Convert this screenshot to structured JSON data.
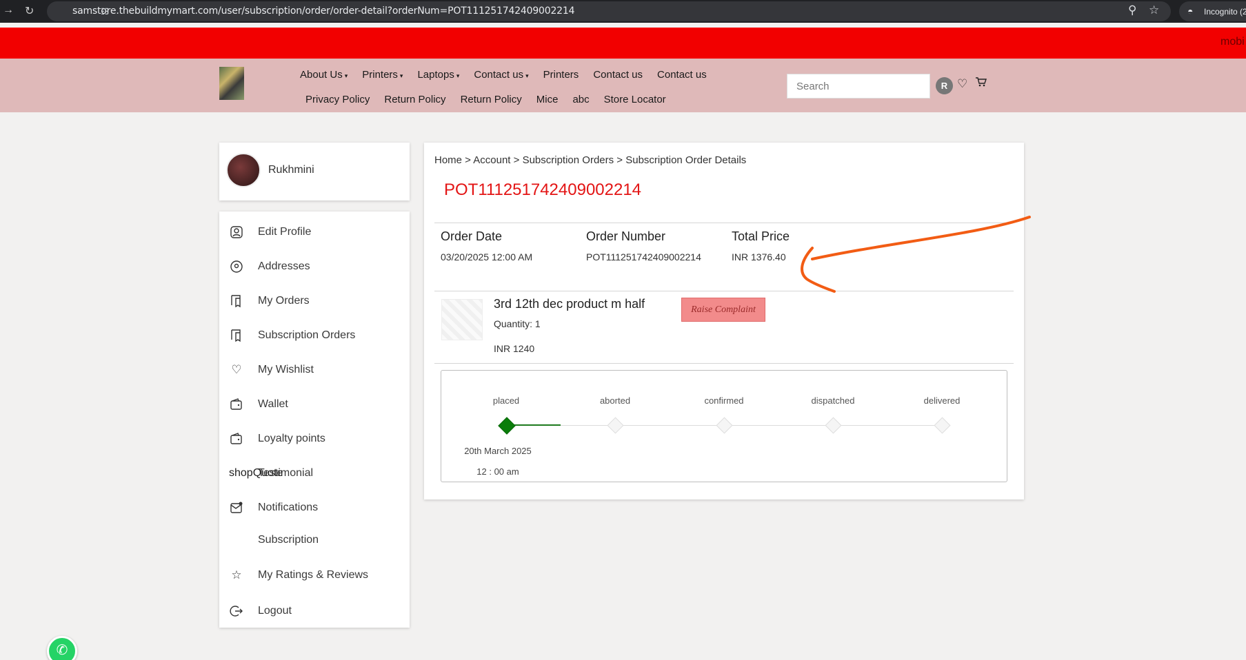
{
  "browser": {
    "url": "samstore.thebuildmymart.com/user/subscription/order/order-detail?orderNum=POT111251742409002214",
    "incognito_label": "Incognito (2"
  },
  "ticker": {
    "text": "mobi"
  },
  "header": {
    "nav_row1": [
      {
        "label": "About Us",
        "dropdown": true
      },
      {
        "label": "Printers",
        "dropdown": true
      },
      {
        "label": "Laptops",
        "dropdown": true
      },
      {
        "label": "Contact us",
        "dropdown": true
      },
      {
        "label": "Printers",
        "dropdown": false
      },
      {
        "label": "Contact us",
        "dropdown": false
      },
      {
        "label": "Contact us",
        "dropdown": false
      }
    ],
    "nav_row2": [
      "Privacy Policy",
      "Return Policy",
      "Return Policy",
      "Mice",
      "abc",
      "Store Locator"
    ],
    "search_placeholder": "Search",
    "avatar_initial": "R"
  },
  "sidebar": {
    "user_name": "Rukhmini",
    "items": [
      {
        "label": "Edit Profile",
        "icon": "user-icon"
      },
      {
        "label": "Addresses",
        "icon": "location-pin-icon"
      },
      {
        "label": "My Orders",
        "icon": "orders-icon"
      },
      {
        "label": "Subscription Orders",
        "icon": "orders-icon"
      },
      {
        "label": "My Wishlist",
        "icon": "heart-icon"
      },
      {
        "label": "Wallet",
        "icon": "wallet-icon"
      },
      {
        "label": "Loyalty points",
        "icon": "wallet-icon"
      },
      {
        "label": "Testimonial",
        "icon": "broken-image",
        "overlay": "shopQuote"
      },
      {
        "label": "Notifications",
        "icon": "mail-icon"
      },
      {
        "label": "Subscription",
        "icon": ""
      },
      {
        "label": "My Ratings & Reviews",
        "icon": "star-icon"
      },
      {
        "label": "Logout",
        "icon": "logout-icon"
      }
    ]
  },
  "main": {
    "breadcrumb": "Home > Account > Subscription Orders > Subscription Order Details",
    "order_title": "POT111251742409002214",
    "summary": {
      "order_date_label": "Order Date",
      "order_date": "03/20/2025 12:00 AM",
      "order_number_label": "Order Number",
      "order_number": "POT111251742409002214",
      "total_price_label": "Total Price",
      "total_price": "INR 1376.40"
    },
    "product": {
      "name": "3rd 12th dec product m half",
      "quantity": "Quantity: 1",
      "price": "INR 1240",
      "complaint_button": "Raise Complaint"
    },
    "tracking": {
      "steps": [
        "placed",
        "aborted",
        "confirmed",
        "dispatched",
        "delivered"
      ],
      "current_step": 0,
      "placed_date": "20th March 2025",
      "placed_time": "12 : 00 am"
    }
  },
  "colors": {
    "order_title": "#e31414",
    "top_banner": "#f20000",
    "header_bg": "#dfb9b9",
    "progress_done": "#0a7d0a",
    "annotation_arrow": "#f25c14"
  }
}
